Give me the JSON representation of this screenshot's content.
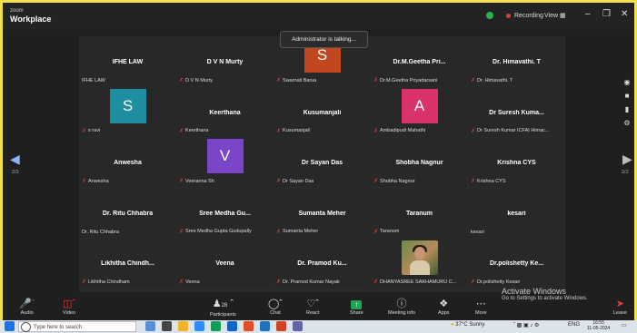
{
  "app": {
    "brand_top": "zoom",
    "brand_name": "Workplace"
  },
  "titlebar": {
    "recording_label": "Recording",
    "view_label": "View"
  },
  "toast": "Administrator is talking...",
  "tiles": [
    {
      "name": "IFHE LAW",
      "label": "IFHE LAW",
      "muted": false,
      "avatar": null
    },
    {
      "name": "D V N Murty",
      "label": "D V N Murty",
      "muted": true,
      "avatar": null
    },
    {
      "name": "",
      "label": "Swarnali Barua",
      "muted": true,
      "avatar": {
        "letter": "S",
        "color": "#c2461e"
      }
    },
    {
      "name": "Dr.M.Geetha  Pri...",
      "label": "Dr.M.Geetha Priyadarsani",
      "muted": true,
      "avatar": null
    },
    {
      "name": "Dr. Himavathi. T",
      "label": "Dr. Himavathi. T",
      "muted": true,
      "avatar": null
    },
    {
      "name": "",
      "label": "s ravi",
      "muted": true,
      "avatar": {
        "letter": "S",
        "color": "#1e8fa0"
      }
    },
    {
      "name": "Keerthana",
      "label": "Keerthana",
      "muted": true,
      "avatar": null
    },
    {
      "name": "Kusumanjali",
      "label": "Kusumanjali",
      "muted": true,
      "avatar": null
    },
    {
      "name": "",
      "label": "Ambadipudi Mahathi",
      "muted": true,
      "avatar": {
        "letter": "A",
        "color": "#d9336a"
      }
    },
    {
      "name": "Dr Suresh Kuma...",
      "label": "Dr Suresh Kumar ICFAI Himac...",
      "muted": true,
      "avatar": null
    },
    {
      "name": "Anwesha",
      "label": "Anwesha",
      "muted": true,
      "avatar": null
    },
    {
      "name": "",
      "label": "Veeranna Sh",
      "muted": true,
      "avatar": {
        "letter": "V",
        "color": "#7a45c8"
      }
    },
    {
      "name": "Dr Sayan Das",
      "label": "Dr Sayan Das",
      "muted": true,
      "avatar": null
    },
    {
      "name": "Shobha Nagnur",
      "label": "Shobha Nagnur",
      "muted": true,
      "avatar": null
    },
    {
      "name": "Krishna CYS",
      "label": "Krishna CYS",
      "muted": true,
      "avatar": null
    },
    {
      "name": "Dr. Ritu Chhabra",
      "label": "Dr. Ritu Chhabra",
      "muted": false,
      "avatar": null
    },
    {
      "name": "Sree Medha  Gu...",
      "label": "Sree Medha Gupta Gudupally",
      "muted": true,
      "avatar": null
    },
    {
      "name": "Sumanta Meher",
      "label": "Sumanta Meher",
      "muted": true,
      "avatar": null
    },
    {
      "name": "Taranum",
      "label": "Taranum",
      "muted": true,
      "avatar": null
    },
    {
      "name": "kesari",
      "label": "kesari",
      "muted": false,
      "avatar": null
    },
    {
      "name": "Likhitha  Chindh...",
      "label": "Likhitha Chindham",
      "muted": true,
      "avatar": null
    },
    {
      "name": "Veena",
      "label": "Veena",
      "muted": true,
      "avatar": null
    },
    {
      "name": "Dr. Pramod  Ku...",
      "label": "Dr. Pramod Kumar Nayak",
      "muted": true,
      "avatar": null
    },
    {
      "name": "",
      "label": "DHANYASREE SAKHAMURU C...",
      "muted": true,
      "avatar": {
        "photo": true
      }
    },
    {
      "name": "Dr.polishetty  Ke...",
      "label": "Dr.polishetty Kesari",
      "muted": true,
      "avatar": null
    }
  ],
  "pager": {
    "left": "2/2",
    "right": "2/2"
  },
  "toolbar": {
    "audio": "Audio",
    "video": "Video",
    "participants": "Participants",
    "participants_count": "28",
    "chat": "Chat",
    "react": "React",
    "share": "Share",
    "meeting_info": "Meeting info",
    "apps": "Apps",
    "more": "More",
    "leave": "Leave"
  },
  "activate": {
    "line1": "Activate Windows",
    "line2": "Go to Settings to activate Windows."
  },
  "taskbar": {
    "search_placeholder": "Type here to search",
    "weather": "37°C  Sunny",
    "lang": "ENG",
    "time": "16:55",
    "date": "11-05-2024"
  }
}
